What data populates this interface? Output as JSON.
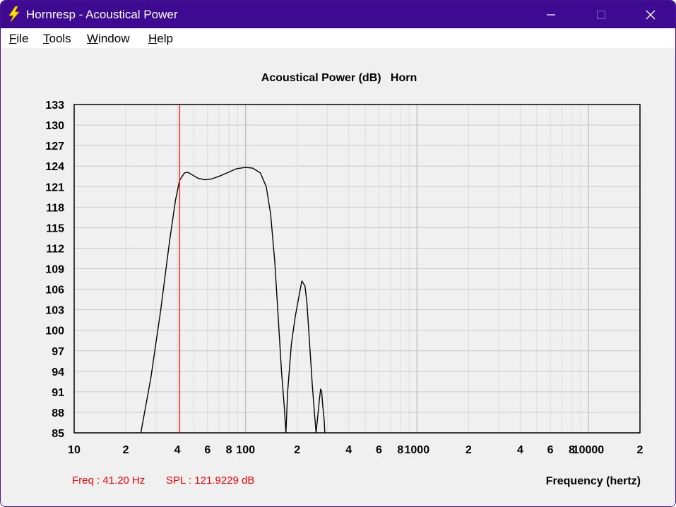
{
  "window": {
    "title": "Hornresp - Acoustical Power",
    "app_icon": "lightning-bolt-icon",
    "controls": [
      "minimize-icon",
      "maximize-icon",
      "close-icon"
    ],
    "title_bar_color": "#3d0a91"
  },
  "menu": {
    "items": [
      "File",
      "Tools",
      "Window",
      "Help"
    ]
  },
  "status": {
    "freq": "Freq : 41.20 Hz",
    "spl": "SPL : 121.9229 dB",
    "color": "#ff0000"
  },
  "chart_data": {
    "type": "line",
    "title": "Acoustical Power (dB)   Horn",
    "xlabel": "Frequency (hertz)",
    "ylabel": "",
    "xscale": "log",
    "xlim": [
      10,
      20000
    ],
    "ylim": [
      85,
      133
    ],
    "y_ticks": [
      85,
      88,
      91,
      94,
      97,
      100,
      103,
      106,
      109,
      112,
      115,
      118,
      121,
      124,
      127,
      130,
      133
    ],
    "x_tick_labels": [
      {
        "x": 10,
        "label": "10"
      },
      {
        "x": 20,
        "label": "2"
      },
      {
        "x": 40,
        "label": "4"
      },
      {
        "x": 60,
        "label": "6"
      },
      {
        "x": 80,
        "label": "8"
      },
      {
        "x": 100,
        "label": "100"
      },
      {
        "x": 200,
        "label": "2"
      },
      {
        "x": 400,
        "label": "4"
      },
      {
        "x": 600,
        "label": "6"
      },
      {
        "x": 800,
        "label": "8"
      },
      {
        "x": 1000,
        "label": "1000"
      },
      {
        "x": 2000,
        "label": "2"
      },
      {
        "x": 4000,
        "label": "4"
      },
      {
        "x": 6000,
        "label": "6"
      },
      {
        "x": 8000,
        "label": "8"
      },
      {
        "x": 10000,
        "label": "10000"
      },
      {
        "x": 20000,
        "label": "2"
      }
    ],
    "grid": true,
    "cursor": {
      "x": 41.2,
      "y": 121.9229,
      "color": "#ff0000"
    },
    "series": [
      {
        "color": "#000000",
        "segments": [
          [
            [
              24.5,
              85
            ],
            [
              28,
              93
            ],
            [
              32,
              103
            ],
            [
              36,
              113
            ],
            [
              39,
              119
            ],
            [
              41.2,
              121.9
            ],
            [
              44,
              123
            ],
            [
              46,
              123.1
            ],
            [
              49,
              122.7
            ],
            [
              53,
              122.2
            ],
            [
              58,
              122
            ],
            [
              63,
              122.1
            ],
            [
              70,
              122.5
            ],
            [
              78,
              123
            ],
            [
              88,
              123.6
            ],
            [
              100,
              123.8
            ],
            [
              110,
              123.7
            ],
            [
              122,
              123
            ],
            [
              132,
              121
            ],
            [
              140,
              117
            ],
            [
              148,
              110
            ],
            [
              155,
              102
            ],
            [
              162,
              94
            ],
            [
              168,
              89
            ],
            [
              172,
              85
            ]
          ],
          [
            [
              172,
              85
            ],
            [
              176,
              91
            ],
            [
              185,
              98
            ],
            [
              195,
              102
            ],
            [
              205,
              105
            ],
            [
              213,
              107.2
            ],
            [
              222,
              106.5
            ],
            [
              228,
              104
            ],
            [
              235,
              99
            ],
            [
              245,
              92
            ],
            [
              252,
              88
            ],
            [
              258,
              85
            ]
          ],
          [
            [
              258,
              85
            ],
            [
              265,
              88
            ],
            [
              270,
              90
            ],
            [
              274,
              91.4
            ],
            [
              278,
              91
            ],
            [
              282,
              89
            ],
            [
              287,
              87
            ],
            [
              290,
              85
            ]
          ]
        ]
      }
    ]
  }
}
